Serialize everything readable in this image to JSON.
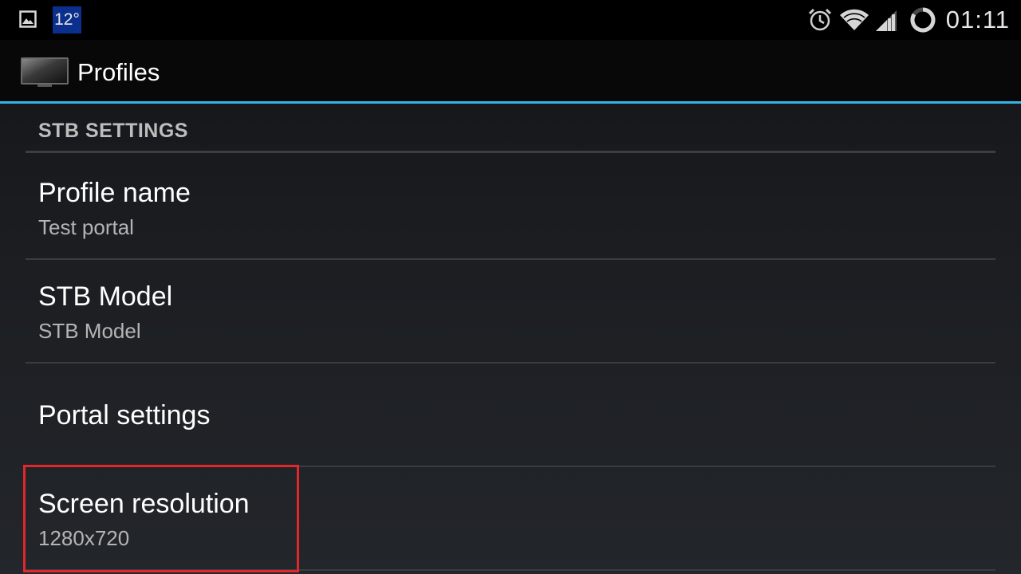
{
  "status_bar": {
    "weather_temp": "12°",
    "time": "01:11",
    "icons": [
      "image-icon",
      "alarm-icon",
      "wifi-icon",
      "signal-icon",
      "battery-icon"
    ]
  },
  "action_bar": {
    "title": "Profiles",
    "accent_color": "#33b5e5"
  },
  "settings": {
    "category": "STB SETTINGS",
    "items": [
      {
        "title": "Profile name",
        "summary": "Test portal"
      },
      {
        "title": "STB Model",
        "summary": "STB Model"
      },
      {
        "title": "Portal settings"
      },
      {
        "title": "Screen resolution",
        "summary": "1280x720"
      }
    ]
  },
  "highlight_color": "#e3262c"
}
